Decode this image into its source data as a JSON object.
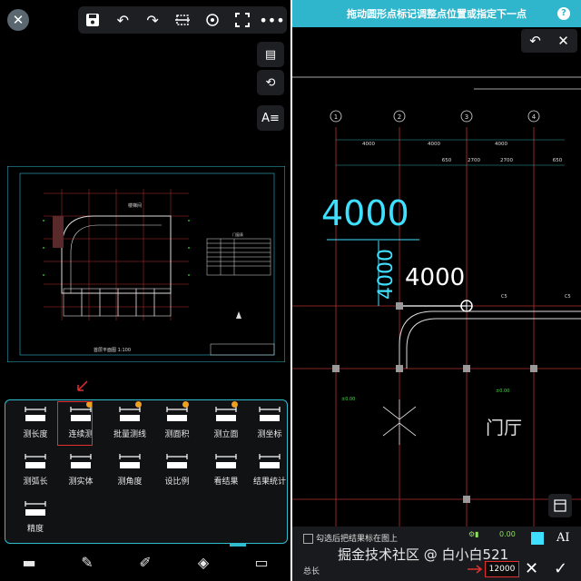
{
  "left": {
    "top_tools": [
      "save-icon",
      "undo-icon",
      "redo-icon",
      "crop-icon",
      "zoom-icon",
      "fullscreen-icon",
      "more-icon"
    ],
    "side_buttons": [
      "comment-icon",
      "collaboration-icon",
      "text-style-icon"
    ],
    "drawing": {
      "title": "首层平面图 1:100",
      "room_label": "楼梯间",
      "table_caption": "门窗表"
    },
    "tools": [
      {
        "label": "测长度",
        "icon": "ruler-icon",
        "badge": false
      },
      {
        "label": "连续测",
        "icon": "ruler-continuous-icon",
        "badge": true
      },
      {
        "label": "批量测线",
        "icon": "batch-measure-icon",
        "badge": true
      },
      {
        "label": "测面积",
        "icon": "area-icon",
        "badge": true
      },
      {
        "label": "测立面",
        "icon": "elevation-icon",
        "badge": true
      },
      {
        "label": "测坐标",
        "icon": "coordinate-icon",
        "badge": false
      },
      {
        "label": "测弧长",
        "icon": "arc-icon",
        "badge": false
      },
      {
        "label": "测实体",
        "icon": "entity-icon",
        "badge": false
      },
      {
        "label": "测角度",
        "icon": "angle-icon",
        "badge": false
      },
      {
        "label": "设比例",
        "icon": "scale-icon",
        "badge": false
      },
      {
        "label": "看结果",
        "icon": "result-icon",
        "badge": false
      },
      {
        "label": "结果统计",
        "icon": "statistics-icon",
        "badge": false
      },
      {
        "label": "精度",
        "icon": "precision-icon",
        "badge": false
      }
    ],
    "bottom_nav": [
      "comment-nav-icon",
      "pencil-nav-icon",
      "edit-nav-icon",
      "layers-nav-icon",
      "measure-nav-icon"
    ]
  },
  "right": {
    "hint": "拖动圆形点标记调整点位置或指定下一点",
    "help": "?",
    "dims": {
      "big": "4000",
      "vertical": "4000",
      "white": "4000",
      "top_row": [
        "4000",
        "4000",
        "4000"
      ],
      "second_row": [
        "650",
        "2700",
        "2700",
        "650"
      ],
      "axis": [
        "1",
        "2",
        "3",
        "4"
      ],
      "elev": [
        "±0.00",
        "±0.00"
      ],
      "col_label": [
        "C5",
        "C5"
      ]
    },
    "room_name": "门厅",
    "checkbox_label": "勾选后把结果标在图上",
    "result_icon_value": "0.00",
    "total_label": "总长",
    "total_value": "12000",
    "watermark": "掘金技术社区 @ 白小白521",
    "colors": {
      "accent": "#2fb6cd",
      "dim": "#3fe0ff",
      "highlight": "#e23030"
    }
  }
}
